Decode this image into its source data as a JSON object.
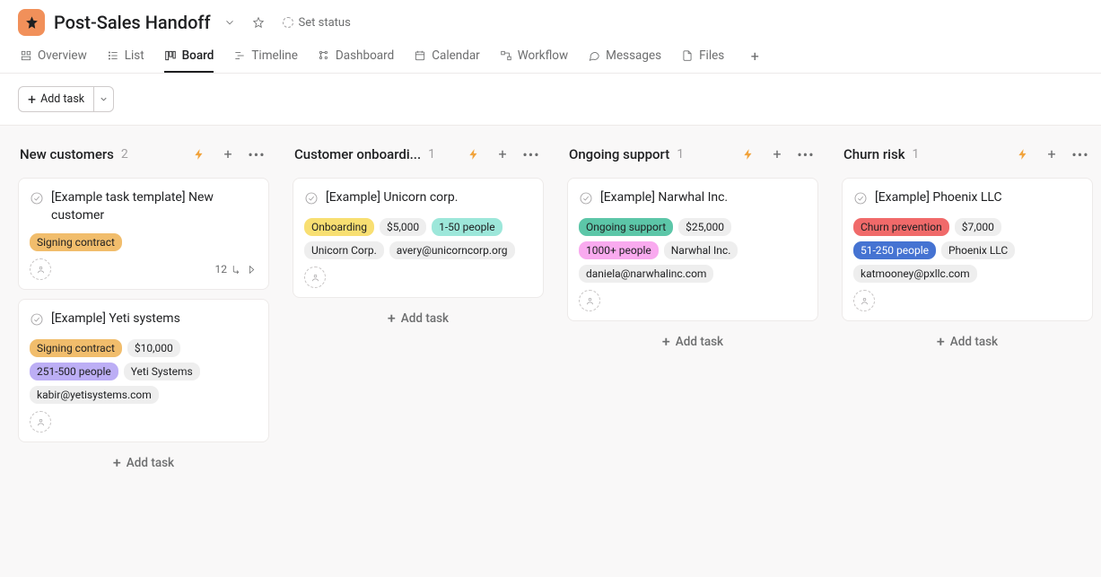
{
  "header": {
    "title": "Post-Sales Handoff",
    "set_status_label": "Set status"
  },
  "tabs": [
    {
      "id": "overview",
      "label": "Overview",
      "active": false
    },
    {
      "id": "list",
      "label": "List",
      "active": false
    },
    {
      "id": "board",
      "label": "Board",
      "active": true
    },
    {
      "id": "timeline",
      "label": "Timeline",
      "active": false
    },
    {
      "id": "dashboard",
      "label": "Dashboard",
      "active": false
    },
    {
      "id": "calendar",
      "label": "Calendar",
      "active": false
    },
    {
      "id": "workflow",
      "label": "Workflow",
      "active": false
    },
    {
      "id": "messages",
      "label": "Messages",
      "active": false
    },
    {
      "id": "files",
      "label": "Files",
      "active": false
    }
  ],
  "toolbar": {
    "add_task_label": "Add task"
  },
  "board": {
    "add_task_label": "Add task",
    "columns": [
      {
        "id": "new-customers",
        "title": "New customers",
        "count": 2,
        "cards": [
          {
            "title": "[Example task template] New customer",
            "tags": [
              {
                "text": "Signing contract",
                "bg": "#f1bd6c",
                "fg": "#1e1f21"
              }
            ],
            "subtasks": 12
          },
          {
            "title": "[Example] Yeti systems",
            "tags": [
              {
                "text": "Signing contract",
                "bg": "#f1bd6c",
                "fg": "#1e1f21"
              },
              {
                "text": "$10,000",
                "bg": "#eeeeee",
                "fg": "#1e1f21"
              },
              {
                "text": "251-500 people",
                "bg": "#bcaef5",
                "fg": "#1e1f21"
              },
              {
                "text": "Yeti Systems",
                "bg": "#eeeeee",
                "fg": "#1e1f21"
              },
              {
                "text": "kabir@yetisystems.com",
                "bg": "#eeeeee",
                "fg": "#1e1f21"
              }
            ]
          }
        ]
      },
      {
        "id": "customer-onboarding",
        "title": "Customer onboardi...",
        "count": 1,
        "cards": [
          {
            "title": "[Example] Unicorn corp.",
            "tags": [
              {
                "text": "Onboarding",
                "bg": "#f8df72",
                "fg": "#1e1f21"
              },
              {
                "text": "$5,000",
                "bg": "#eeeeee",
                "fg": "#1e1f21"
              },
              {
                "text": "1-50 people",
                "bg": "#9de7da",
                "fg": "#1e1f21"
              },
              {
                "text": "Unicorn Corp.",
                "bg": "#eeeeee",
                "fg": "#1e1f21"
              },
              {
                "text": "avery@unicorncorp.org",
                "bg": "#eeeeee",
                "fg": "#1e1f21"
              }
            ]
          }
        ]
      },
      {
        "id": "ongoing-support",
        "title": "Ongoing support",
        "count": 1,
        "cards": [
          {
            "title": "[Example] Narwhal Inc.",
            "tags": [
              {
                "text": "Ongoing support",
                "bg": "#5cc6a8",
                "fg": "#1e1f21"
              },
              {
                "text": "$25,000",
                "bg": "#eeeeee",
                "fg": "#1e1f21"
              },
              {
                "text": "1000+ people",
                "bg": "#f9aaef",
                "fg": "#1e1f21"
              },
              {
                "text": "Narwhal Inc.",
                "bg": "#eeeeee",
                "fg": "#1e1f21"
              },
              {
                "text": "daniela@narwhalinc.com",
                "bg": "#eeeeee",
                "fg": "#1e1f21"
              }
            ]
          }
        ]
      },
      {
        "id": "churn-risk",
        "title": "Churn risk",
        "count": 1,
        "cards": [
          {
            "title": "[Example] Phoenix LLC",
            "tags": [
              {
                "text": "Churn prevention",
                "bg": "#f06a6a",
                "fg": "#1e1f21"
              },
              {
                "text": "$7,000",
                "bg": "#eeeeee",
                "fg": "#1e1f21"
              },
              {
                "text": "51-250 people",
                "bg": "#4573d2",
                "fg": "#ffffff"
              },
              {
                "text": "Phoenix LLC",
                "bg": "#eeeeee",
                "fg": "#1e1f21"
              },
              {
                "text": "katmooney@pxllc.com",
                "bg": "#eeeeee",
                "fg": "#1e1f21"
              }
            ]
          }
        ]
      }
    ]
  }
}
